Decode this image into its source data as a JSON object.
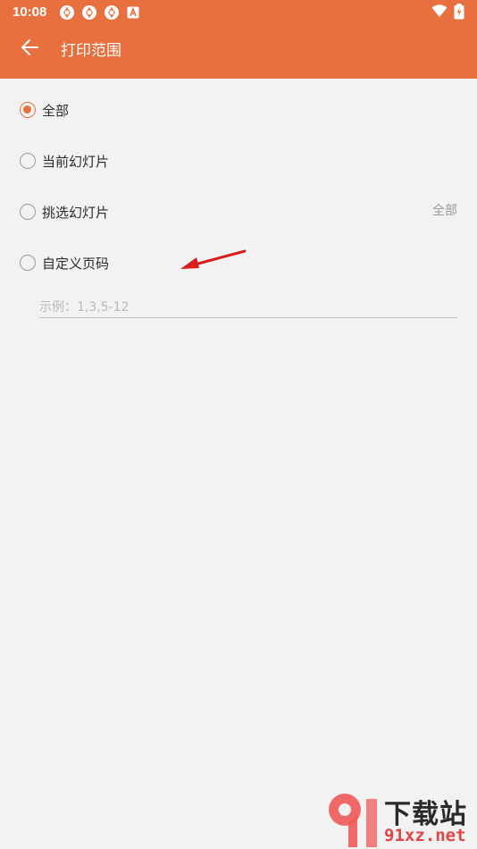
{
  "status_bar": {
    "time": "10:08",
    "notifications": [
      "sync-icon",
      "sync-icon",
      "sync-icon",
      "app-a-icon"
    ],
    "right_icons": [
      "wifi-icon",
      "battery-icon"
    ]
  },
  "toolbar": {
    "title": "打印范围",
    "back_icon": "arrow-left-icon"
  },
  "options": [
    {
      "label": "全部",
      "checked": true,
      "value": ""
    },
    {
      "label": "当前幻灯片",
      "checked": false,
      "value": ""
    },
    {
      "label": "挑选幻灯片",
      "checked": false,
      "value": "全部"
    },
    {
      "label": "自定义页码",
      "checked": false,
      "value": ""
    }
  ],
  "custom_pages": {
    "value": "",
    "placeholder": "示例：1,3,5-12"
  },
  "watermark": {
    "title": "下载站",
    "url": "91xz.net"
  },
  "colors": {
    "accent": "#e8703e",
    "background": "#f2f2f2",
    "annotation_arrow": "#d91c1c"
  }
}
